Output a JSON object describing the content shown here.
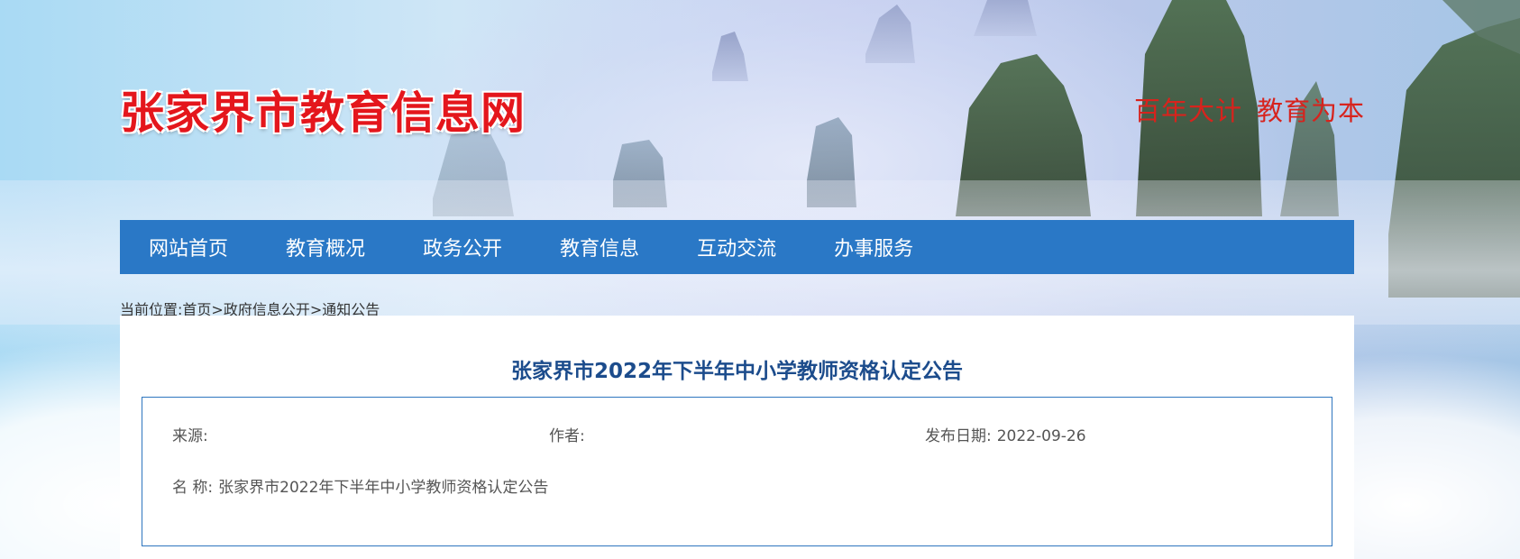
{
  "site": {
    "logo_text": "张家界市教育信息网",
    "slogan_part1": "百年大计",
    "slogan_part2": "教育为本"
  },
  "nav": {
    "items": [
      "网站首页",
      "教育概况",
      "政务公开",
      "教育信息",
      "互动交流",
      "办事服务"
    ]
  },
  "breadcrumb": {
    "prefix": "当前位置:",
    "home": "首页",
    "sep1": ">",
    "section": "政府信息公开",
    "sep2": ">",
    "current": "通知公告"
  },
  "article": {
    "title": "张家界市2022年下半年中小学教师资格认定公告",
    "source_label": "来源:",
    "source_value": "",
    "author_label": "作者:",
    "author_value": "",
    "date_label": "发布日期:",
    "date_value": "2022-09-26",
    "name_label": "名 称:",
    "name_value": "张家界市2022年下半年中小学教师资格认定公告"
  },
  "colors": {
    "nav_bg": "#2a78c6",
    "logo_red": "#e4161c",
    "title_blue": "#1c4c8c",
    "box_border": "#2e76bf"
  }
}
